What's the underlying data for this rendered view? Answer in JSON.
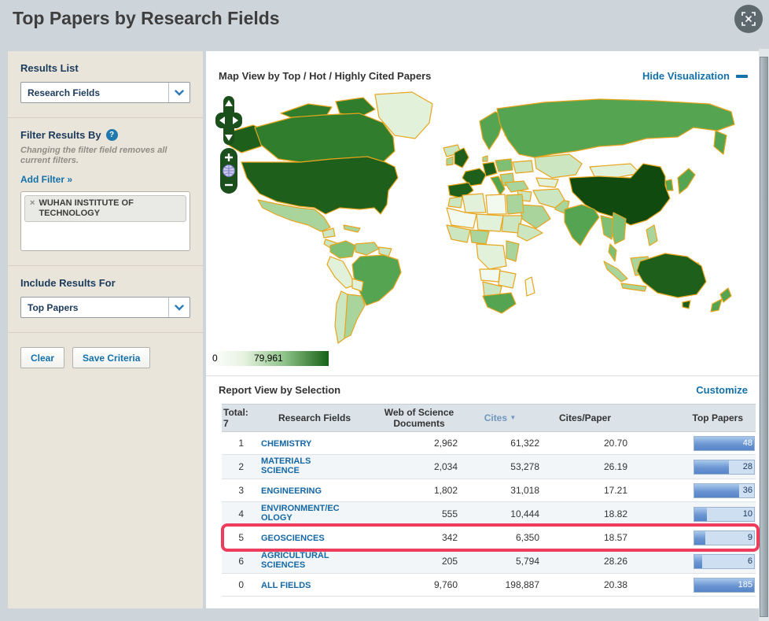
{
  "page": {
    "title": "Top Papers by Research Fields"
  },
  "sidebar": {
    "results_list": {
      "label": "Results List",
      "selected": "Research Fields"
    },
    "filter": {
      "label": "Filter Results By",
      "help": "?",
      "note": "Changing the filter field removes all current filters.",
      "add_filter": "Add Filter »",
      "tag": {
        "remove": "×",
        "label": "WUHAN INSTITUTE OF TECHNOLOGY"
      }
    },
    "include": {
      "label": "Include Results For",
      "selected": "Top Papers"
    },
    "buttons": {
      "clear": "Clear",
      "save": "Save Criteria"
    }
  },
  "map": {
    "title": "Map View by Top / Hot / Highly Cited Papers",
    "hide_link": "Hide Visualization",
    "legend": {
      "min": "0",
      "max": "79,961"
    },
    "colors": {
      "scale_min": "#ffffff",
      "scale_max": "#176117",
      "country_outline": "#e8a41c"
    }
  },
  "report": {
    "title": "Report View by Selection",
    "customize": "Customize",
    "table": {
      "total_label": "Total:",
      "total_value": "7",
      "columns": {
        "field": "Research Fields",
        "docs": "Web of Science Documents",
        "cites": "Cites",
        "cites_per_paper": "Cites/Paper",
        "top_papers": "Top Papers"
      },
      "sort": {
        "column": "Cites",
        "direction": "desc"
      },
      "rows": [
        {
          "rank": "1",
          "field": "CHEMISTRY",
          "docs": "2,962",
          "cites": "61,322",
          "cites_per_paper": "20.70",
          "top_papers": "48",
          "bar_pct": 100,
          "highlighted": false
        },
        {
          "rank": "2",
          "field": "MATERIALS SCIENCE",
          "docs": "2,034",
          "cites": "53,278",
          "cites_per_paper": "26.19",
          "top_papers": "28",
          "bar_pct": 58,
          "highlighted": false
        },
        {
          "rank": "3",
          "field": "ENGINEERING",
          "docs": "1,802",
          "cites": "31,018",
          "cites_per_paper": "17.21",
          "top_papers": "36",
          "bar_pct": 75,
          "highlighted": false
        },
        {
          "rank": "4",
          "field": "ENVIRONMENT/ECOLOGY",
          "docs": "555",
          "cites": "10,444",
          "cites_per_paper": "18.82",
          "top_papers": "10",
          "bar_pct": 21,
          "highlighted": false
        },
        {
          "rank": "5",
          "field": "GEOSCIENCES",
          "docs": "342",
          "cites": "6,350",
          "cites_per_paper": "18.57",
          "top_papers": "9",
          "bar_pct": 19,
          "highlighted": true
        },
        {
          "rank": "6",
          "field": "AGRICULTURAL SCIENCES",
          "docs": "205",
          "cites": "5,794",
          "cites_per_paper": "28.26",
          "top_papers": "6",
          "bar_pct": 13,
          "highlighted": false
        },
        {
          "rank": "0",
          "field": "ALL FIELDS",
          "docs": "9,760",
          "cites": "198,887",
          "cites_per_paper": "20.38",
          "top_papers": "185",
          "bar_pct": 100,
          "highlighted": false
        }
      ]
    }
  },
  "colors": {
    "accent_blue": "#1270ab",
    "highlight_red": "#ee3d5c",
    "bar_fill": "#5585c8",
    "bar_track": "#cfdff2"
  }
}
